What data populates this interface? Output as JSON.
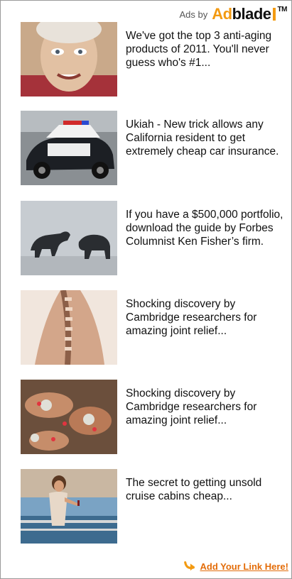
{
  "header": {
    "ads_by": "Ads by",
    "logo": {
      "a": "Ad",
      "rest": "blade",
      "tm": "TM"
    }
  },
  "ads": [
    {
      "text": "We've got the top 3 anti-aging products of 2011. You'll never guess who's #1...",
      "image": "elderly-woman-photo"
    },
    {
      "text": "Ukiah - New trick allows any California resident to get extremely cheap car insurance.",
      "image": "police-car-photo"
    },
    {
      "text": "If you have a $500,000 portfolio, download the guide by Forbes Columnist Ken Fisher’s firm.",
      "image": "bull-bear-photo"
    },
    {
      "text": "Shocking discovery by Cambridge researchers for amazing joint relief...",
      "image": "spine-back-photo"
    },
    {
      "text": "Shocking discovery by Cambridge researchers for amazing joint relief...",
      "image": "joints-illustration"
    },
    {
      "text": "The secret to getting unsold cruise cabins cheap...",
      "image": "cruise-woman-photo"
    }
  ],
  "footer": {
    "link_text": "Add Your Link Here!"
  },
  "colors": {
    "accent": "#f39a11",
    "link": "#e36c09"
  }
}
